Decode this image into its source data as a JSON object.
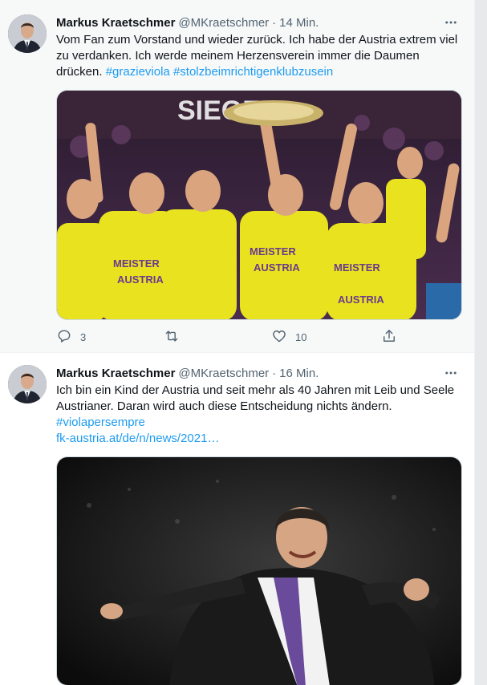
{
  "colors": {
    "accent": "#1d9bf0",
    "text": "#0f1419",
    "muted": "#536471",
    "border": "#eff3f4"
  },
  "tweets": [
    {
      "author_name": "Markus Kraetschmer",
      "handle": "@MKraetschmer",
      "separator": "·",
      "time": "14 Min.",
      "text": "Vom Fan zum Vorstand und wieder zurück. Ich habe der Austria extrem viel zu verdanken. Ich werde meinem Herzensverein immer die Daumen drücken.",
      "hashtags": [
        "#grazieviola",
        "#stolzbeimrichtigenklubzusein"
      ],
      "media_icon": "photo-celebration-trophy",
      "reply_count": "3",
      "retweet_count": "",
      "like_count": "10"
    },
    {
      "author_name": "Markus Kraetschmer",
      "handle": "@MKraetschmer",
      "separator": "·",
      "time": "16 Min.",
      "text": "Ich bin ein Kind der Austria und seit mehr als 40 Jahren mit Leib und Seele Austrianer. Daran wird auch diese Entscheidung nichts ändern.",
      "hashtag": "#violapersempre",
      "link": "fk-austria.at/de/n/news/2021…",
      "media_icon": "photo-man-cheering"
    }
  ]
}
